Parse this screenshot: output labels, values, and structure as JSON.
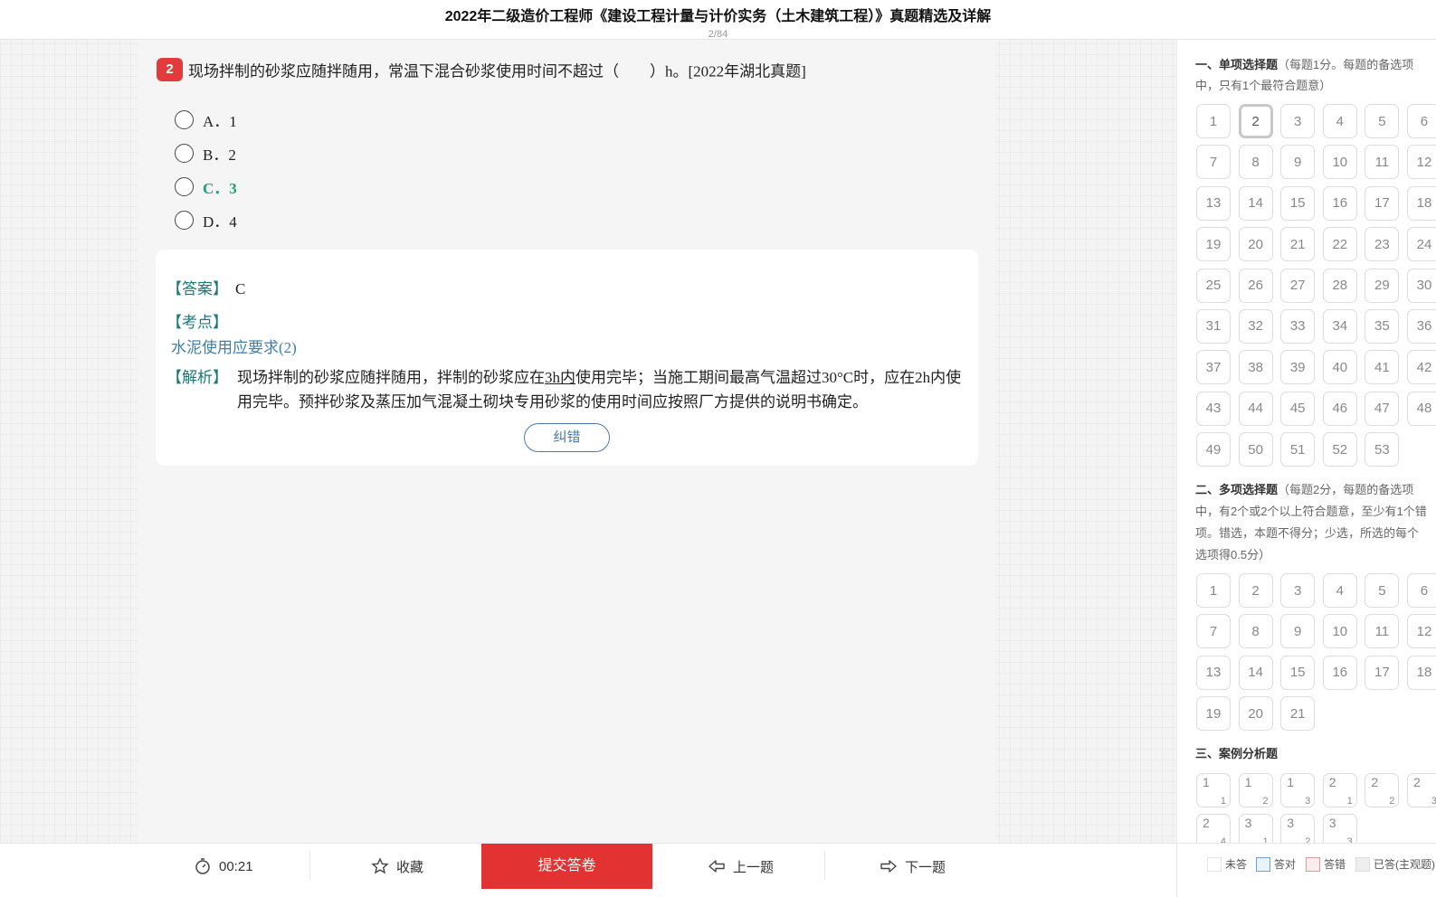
{
  "header": {
    "title": "2022年二级造价工程师《建设工程计量与计价实务（土木建筑工程）》真题精选及详解",
    "progress": "2/84"
  },
  "question": {
    "number": "2",
    "text": "现场拌制的砂浆应随拌随用，常温下混合砂浆使用时间不超过（　　）h。[2022年湖北真题]",
    "options": [
      {
        "label": "A．1"
      },
      {
        "label": "B．2"
      },
      {
        "label": "C．3"
      },
      {
        "label": "D．4"
      }
    ],
    "correct_index": 2
  },
  "analysis": {
    "answer_label": "【答案】",
    "answer_value": "C",
    "kp_label": "【考点】",
    "kp_link": "水泥使用应要求(2)",
    "jx_label": "【解析】",
    "jx_text_1": "现场拌制的砂浆应随拌随用，拌制的砂浆应在",
    "jx_u1": "3h内",
    "jx_text_2": "使用完毕；当施工期间最高气温超过30°C时，应在2h内使用完毕。预拌砂浆及蒸压加气混凝土砌块专用砂浆的使用时间应按照厂方提供的说明书确定。",
    "correct_button": "纠错"
  },
  "side": {
    "sec1": {
      "title": "一、单项选择题",
      "desc1": "（每题1分。每题的备选项",
      "desc2": "中，只有1个最符合题意）",
      "count": 53,
      "current": 2
    },
    "sec2": {
      "title": "二、多项选择题",
      "desc1": "（每题2分，每题的备选项",
      "desc2": "中，有2个或2个以上符合题意，至少有1个错",
      "desc3": "项。错选，本题不得分；少选，所选的每个",
      "desc4": "选项得0.5分）",
      "count": 21
    },
    "sec3": {
      "title": "三、案例分析题",
      "cases": [
        [
          "1",
          "1"
        ],
        [
          "1",
          "2"
        ],
        [
          "1",
          "3"
        ],
        [
          "2",
          "1"
        ],
        [
          "2",
          "2"
        ],
        [
          "2",
          "3"
        ],
        [
          "2",
          "4"
        ],
        [
          "3",
          "1"
        ],
        [
          "3",
          "2"
        ],
        [
          "3",
          "3"
        ]
      ]
    }
  },
  "bottom": {
    "timer": "00:21",
    "favorite": "收藏",
    "submit": "提交答卷",
    "prev": "上一题",
    "next": "下一题",
    "legend": [
      "未答",
      "答对",
      "答错",
      "已答(主观题)"
    ]
  }
}
